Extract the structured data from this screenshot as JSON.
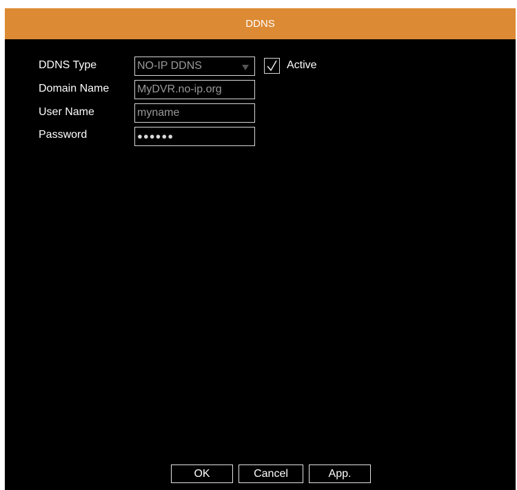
{
  "dialog": {
    "title": "DDNS"
  },
  "form": {
    "ddns_type": {
      "label": "DDNS Type",
      "value": "NO-IP DDNS"
    },
    "active": {
      "label": "Active",
      "checked": true
    },
    "domain_name": {
      "label": "Domain Name",
      "value": "MyDVR.no-ip.org"
    },
    "user_name": {
      "label": "User Name",
      "value": "myname"
    },
    "password": {
      "label": "Password",
      "value": "●●●●●●"
    }
  },
  "buttons": {
    "ok": "OK",
    "cancel": "Cancel",
    "apply": "App."
  },
  "colors": {
    "title_bar": "#dc8a34",
    "background": "#000000",
    "text": "#ffffff",
    "field_text": "#9a9a9a",
    "border": "#d8d8d8"
  }
}
